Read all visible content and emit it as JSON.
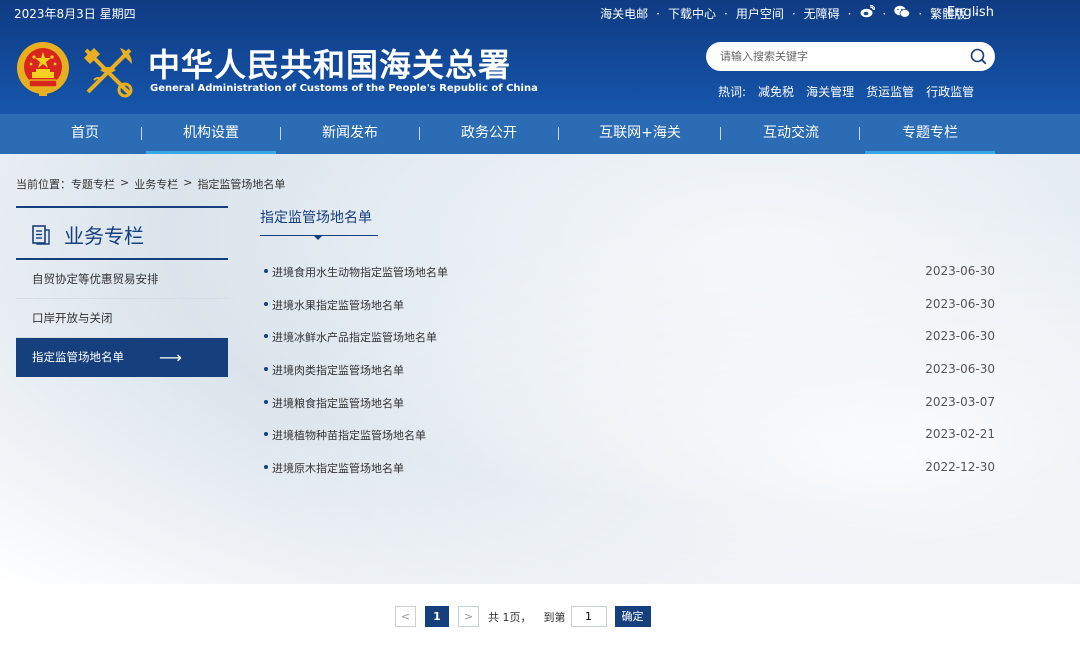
{
  "header": {
    "date": "2023年8月3日 星期四",
    "top_links": [
      "海关电邮",
      "下载中心",
      "用户空间",
      "无障碍"
    ],
    "traditional": "繁體版",
    "english": "English",
    "title": "中华人民共和国海关总署",
    "subtitle": "General Administration of Customs of the People's Republic of China",
    "search_placeholder": "请输入搜索关键字",
    "hot_label": "热词:",
    "hot_words": [
      "减免税",
      "海关管理",
      "货运监管",
      "行政监管"
    ]
  },
  "nav": {
    "items": [
      "首页",
      "机构设置",
      "新闻发布",
      "政务公开",
      "互联网+海关",
      "互动交流",
      "专题专栏"
    ]
  },
  "breadcrumb": {
    "label": "当前位置：",
    "items": [
      "专题专栏",
      "业务专栏",
      "指定监管场地名单"
    ],
    "sep": ">"
  },
  "sidebar": {
    "title": "业务专栏",
    "items": [
      {
        "label": "自贸协定等优惠贸易安排"
      },
      {
        "label": "口岸开放与关闭"
      },
      {
        "label": "指定监管场地名单"
      }
    ]
  },
  "main": {
    "title": "指定监管场地名单",
    "rows": [
      {
        "title": "进境食用水生动物指定监管场地名单",
        "date": "2023-06-30"
      },
      {
        "title": "进境水果指定监管场地名单",
        "date": "2023-06-30"
      },
      {
        "title": "进境冰鲜水产品指定监管场地名单",
        "date": "2023-06-30"
      },
      {
        "title": "进境肉类指定监管场地名单",
        "date": "2023-06-30"
      },
      {
        "title": "进境粮食指定监管场地名单",
        "date": "2023-03-07"
      },
      {
        "title": "进境植物种苗指定监管场地名单",
        "date": "2023-02-21"
      },
      {
        "title": "进境原木指定监管场地名单",
        "date": "2022-12-30"
      }
    ]
  },
  "pager": {
    "prev": "<",
    "next": ">",
    "current": "1",
    "total_text": "共 1页，",
    "goto_text": "到第",
    "goto_value": "1",
    "confirm": "确定"
  },
  "colors": {
    "brand_dark": "#163f7e",
    "header": "#134b9c",
    "nav": "#2b6cb5",
    "nav_active_underline": "#3aa6e8"
  }
}
